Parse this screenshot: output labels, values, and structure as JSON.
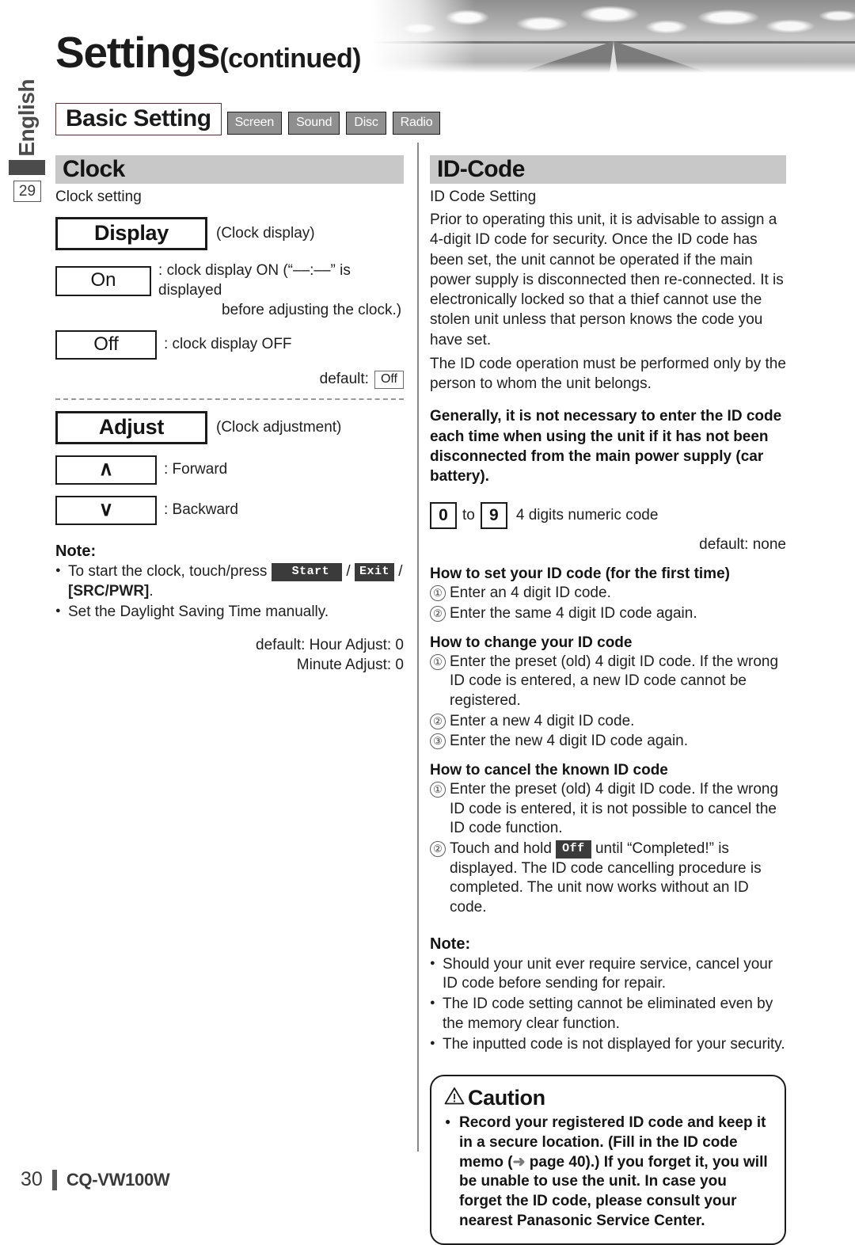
{
  "header": {
    "title": "Settings",
    "title_suffix": "(continued)",
    "language_tab": "English",
    "page_reference": "29",
    "basic_setting_label": "Basic Setting",
    "tabs": [
      {
        "label": "Screen"
      },
      {
        "label": "Sound"
      },
      {
        "label": "Disc"
      },
      {
        "label": "Radio"
      }
    ]
  },
  "left_column": {
    "section_title": "Clock",
    "section_subtitle": "Clock setting",
    "display_group": {
      "box_label": "Display",
      "paren_label": "(Clock display)",
      "options": [
        {
          "box_label": "On",
          "description": ": clock display ON (“––:––” is displayed",
          "description_line2": "before adjusting the clock.)"
        },
        {
          "box_label": "Off",
          "description": ": clock display OFF",
          "description_line2": ""
        }
      ],
      "default_label": "default:",
      "default_value": "Off"
    },
    "adjust_group": {
      "box_label": "Adjust",
      "paren_label": "(Clock adjustment)",
      "options": [
        {
          "box_glyph": "∧",
          "description": ": Forward",
          "icon_name": "chevron-up-icon"
        },
        {
          "box_glyph": "∨",
          "description": ": Backward",
          "icon_name": "chevron-down-icon"
        }
      ],
      "note_heading": "Note:",
      "note_bullet_1_pre": "To start the clock, touch/press",
      "note_btn_start": "Start",
      "note_slash_1": "/",
      "note_btn_exit": "Exit",
      "note_slash_2": "/",
      "note_bullet_1_post": "[SRC/PWR]",
      "note_bullet_1_end": ".",
      "note_bullet_2": "Set the Daylight Saving Time manually.",
      "default_line_1": "default: Hour Adjust: 0",
      "default_line_2": "Minute Adjust: 0"
    }
  },
  "right_column": {
    "section_title": "ID-Code",
    "section_subtitle": "ID Code Setting",
    "intro_paragraph_1": "Prior to operating this unit, it is advisable to assign a 4-digit ID code for security. Once the ID code has been set, the unit cannot be operated if the main power supply is disconnected then re-connected. It is electronically locked so that a thief cannot use the stolen unit unless that person knows the code you have set.",
    "intro_paragraph_2": "The ID code operation must be performed only by the person to whom the unit belongs.",
    "bold_paragraph": "Generally, it is not necessary to enter the ID code each time when using the unit if it has not been disconnected from the main power supply (car battery).",
    "digit_range": {
      "from": "0",
      "to_label": "to",
      "to": "9",
      "description": "4 digits numeric code",
      "default": "default: none"
    },
    "how_to_set": {
      "heading": "How to set your ID code (for the first time)",
      "steps": [
        {
          "num": "①",
          "text": "Enter an 4 digit ID code."
        },
        {
          "num": "②",
          "text": "Enter the same 4 digit ID code again."
        }
      ]
    },
    "how_to_change": {
      "heading": "How to change your ID code",
      "steps": [
        {
          "num": "①",
          "text": "Enter the preset (old) 4 digit ID code. If the wrong ID code is entered, a new ID code cannot be registered."
        },
        {
          "num": "②",
          "text": "Enter a new 4 digit ID code."
        },
        {
          "num": "③",
          "text": "Enter the new 4 digit ID code again."
        }
      ]
    },
    "how_to_cancel": {
      "heading": "How to cancel the known ID code",
      "step_1_num": "①",
      "step_1_text": "Enter the preset (old) 4 digit ID code. If the wrong ID code is entered, it is not possible to cancel the ID code function.",
      "step_2_num": "②",
      "step_2_pre": "Touch and hold",
      "step_2_btn": "Off",
      "step_2_post": "until “Completed!” is displayed. The ID code cancelling procedure is completed. The unit now works without an ID code."
    },
    "note": {
      "heading": "Note:",
      "bullets": [
        "Should your unit ever require service, cancel your ID code before sending for repair.",
        "The ID code setting cannot be eliminated even by the memory clear function.",
        "The inputted code is not displayed for your security."
      ]
    },
    "caution": {
      "title": "Caution",
      "warning_glyph": "⚠",
      "body_1": "Record your registered ID code and keep it in a secure location. (Fill in the ID code memo (",
      "arrow": "➜",
      "body_2": " page 40).) If you forget it, you will be unable to use the unit. In case you forget the ID code, please consult your nearest Panasonic Service Center."
    }
  },
  "footer": {
    "page_number": "30",
    "model": "CQ-VW100W"
  },
  "colors": {
    "section_header_bg": "#c8c8c8",
    "tab_bg": "#8f8f8f",
    "ink": "#1b1b1b",
    "muted": "#5a5a5a"
  }
}
